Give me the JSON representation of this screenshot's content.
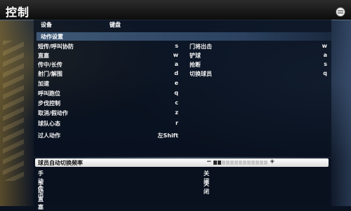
{
  "screen": {
    "title": "控制"
  },
  "tabs": {
    "device": "设备",
    "keyboard": "键盘"
  },
  "section": {
    "header": "动作设置"
  },
  "left_bindings": [
    {
      "label": "短传/呼叫协防",
      "key": "s"
    },
    {
      "label": "直塞",
      "key": "w"
    },
    {
      "label": "传中/长传",
      "key": "a"
    },
    {
      "label": "射门/解围",
      "key": "d"
    },
    {
      "label": "加速",
      "key": "e"
    },
    {
      "label": "呼叫跑位",
      "key": "q"
    },
    {
      "label": "步伐控制",
      "key": "c"
    },
    {
      "label": "取消/假动作",
      "key": "z"
    },
    {
      "label": "球队心态",
      "key": "r"
    },
    {
      "label": "过人动作",
      "key": "左Shift"
    }
  ],
  "right_bindings": [
    {
      "label": "门将出击",
      "key": "w"
    },
    {
      "label": "铲球",
      "key": "a"
    },
    {
      "label": "抢断",
      "key": "s"
    },
    {
      "label": "切换球员",
      "key": "q"
    }
  ],
  "options": {
    "auto_switch": {
      "label": "球员自动切换频率",
      "minus": "−",
      "plus": "+",
      "level_fraction": 0.15,
      "segments_total": 13
    },
    "manual_cross": {
      "label": "手动传中",
      "value": "关闭"
    },
    "manual_through": {
      "label": "手动直塞",
      "value": "关闭"
    }
  },
  "colors": {
    "highlight_bar": "#ffffff",
    "section_header": "#3e5876",
    "text": "#f2f2f2"
  },
  "icons": {
    "menu": "menu-icon"
  }
}
